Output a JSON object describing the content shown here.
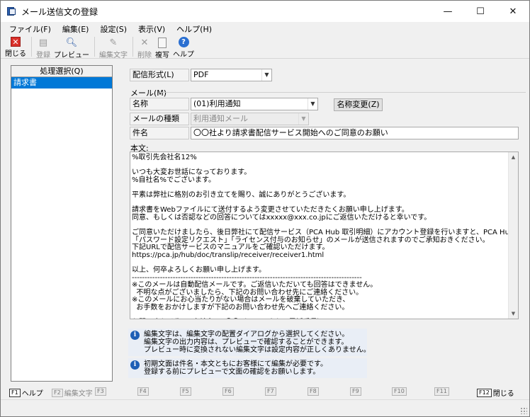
{
  "window": {
    "title": "メール送信文の登録",
    "controls": {
      "minimize": "—",
      "maximize": "☐",
      "close": "✕"
    }
  },
  "menu": [
    "ファイル(F)",
    "編集(E)",
    "設定(S)",
    "表示(V)",
    "ヘルプ(H)"
  ],
  "toolbar": [
    {
      "label": "閉じる",
      "icon": "close-icon",
      "enabled": true
    },
    {
      "label": "登録",
      "icon": "register-icon",
      "enabled": false
    },
    {
      "label": "プレビュー",
      "icon": "preview-icon",
      "enabled": true
    },
    {
      "label": "編集文字",
      "icon": "edit-text-icon",
      "enabled": false
    },
    {
      "label": "削除",
      "icon": "delete-icon",
      "enabled": false
    },
    {
      "label": "複写",
      "icon": "copy-icon",
      "enabled": true
    },
    {
      "label": "ヘルプ",
      "icon": "help-icon",
      "enabled": true
    }
  ],
  "left_panel": {
    "header": "処理選択(Q)",
    "items": [
      "請求書"
    ]
  },
  "form": {
    "delivery_format_label": "配信形式(L)",
    "delivery_format_value": "PDF",
    "mail_group_label": "メール(M)",
    "name_label": "名称",
    "name_value": "(01)利用通知",
    "rename_button": "名称変更(Z)",
    "mail_type_label": "メールの種類",
    "mail_type_value": "利用通知メール",
    "subject_label": "件名",
    "subject_value": "〇〇社より請求書配信サービス開始へのご同意のお願い",
    "body_label": "本文:",
    "body_text": "%取引先会社名12%\n\nいつも大変お世話になっております。\n%自社名%でございます。\n\n平素は弊社に格別のお引き立てを賜り、誠にありがとうございます。\n\n請求書をWebファイルにて送付するよう変更させていただきたくお願い申し上げます。\n同意、もしくは否認などの回答についてはxxxxx@xxx.co.jpにご返信いただけると幸いです。\n\nご同意いただけましたら、後日弊社にて配信サービス（PCA Hub 取引明細）にアカウント登録を行いますと、PCA Hubから\n「パスワード設定リクエスト」「ライセンス付与のお知らせ」のメールが送信されますのでご承知おきください。\n下記URLで配信サービスのマニュアルをご確認いただけます。\nhttps://pca.jp/hub/doc/translip/receiver/receiver1.html\n\n以上、何卒よろしくお願い申し上げます。\n------------------------------------------------------------------------------------------\n※このメールは自動配信メールです。ご返信いただいても回答はできません。\n  不明な点がございましたら、下記のお問い合わせ先にご連絡ください。\n※このメールにお心当たりがない場合はメールを破棄していただき、\n  お手数をおかけしますが下記のお問い合わせ先へご連絡ください。\n\nお問い合わせ先  %自社名%  〇〇（メールまたは電話番号）\n------------------------------------------------------------------------------------------"
  },
  "info_boxes": [
    {
      "lines": [
        "編集文字は、編集文字の配置ダイアログから選択してください。",
        "編集文字の出力内容は、プレビューで確認することができます。",
        "プレビュー時に変換されない編集文字は設定内容が正しくありません。"
      ]
    },
    {
      "lines": [
        "初期文面は件名・本文ともにお客様にて編集が必要です。",
        "登録する前にプレビューで文面の確認をお願いします。"
      ]
    }
  ],
  "function_keys": [
    {
      "key": "F1",
      "label": "ヘルプ",
      "enabled": true
    },
    {
      "key": "F2",
      "label": "編集文字",
      "enabled": false
    },
    {
      "key": "F3",
      "label": "",
      "enabled": false
    },
    {
      "key": "F4",
      "label": "",
      "enabled": false
    },
    {
      "key": "F5",
      "label": "",
      "enabled": false
    },
    {
      "key": "F6",
      "label": "",
      "enabled": false
    },
    {
      "key": "F7",
      "label": "",
      "enabled": false
    },
    {
      "key": "F8",
      "label": "",
      "enabled": false
    },
    {
      "key": "F9",
      "label": "",
      "enabled": false
    },
    {
      "key": "F10",
      "label": "",
      "enabled": false
    },
    {
      "key": "F11",
      "label": "",
      "enabled": false
    },
    {
      "key": "F12",
      "label": "閉じる",
      "enabled": true
    }
  ],
  "colors": {
    "selection": "#0078d7",
    "info_bg": "#e9eef6",
    "close_red": "#d9302a"
  }
}
